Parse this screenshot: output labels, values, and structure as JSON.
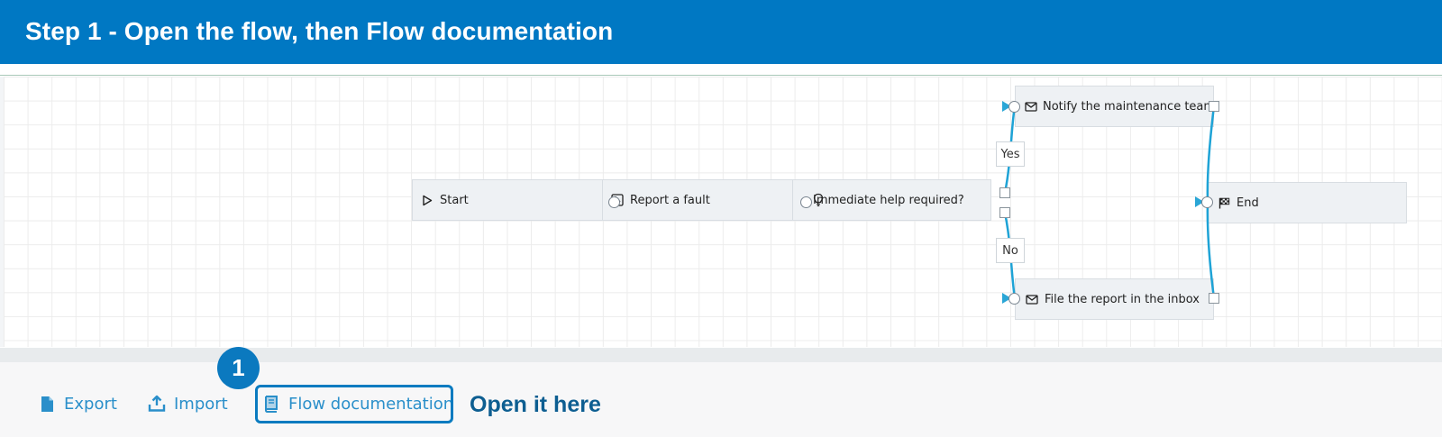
{
  "header": {
    "title": "Step 1 - Open the flow, then Flow documentation"
  },
  "flow": {
    "nodes": {
      "start": {
        "label": "Start",
        "icon": "play-outline-icon"
      },
      "report": {
        "label": "Report a fault",
        "icon": "form-icon"
      },
      "decision": {
        "label": "Immediate help required?",
        "icon": "lightbulb-icon"
      },
      "notify": {
        "label": "Notify the maintenance team",
        "icon": "envelope-icon"
      },
      "file": {
        "label": "File the report in the inbox",
        "icon": "envelope-icon"
      },
      "end": {
        "label": "End",
        "icon": "checkered-flag-icon"
      }
    },
    "edge_labels": {
      "yes": "Yes",
      "no": "No"
    },
    "colors": {
      "link": "#1ea3d6",
      "node_bg": "#eef1f4"
    }
  },
  "toolbar": {
    "export_label": "Export",
    "import_label": "Import",
    "flowdoc_label": "Flow documentation",
    "accent": "#2a8fca"
  },
  "callout": {
    "step_number": "1",
    "text": "Open it here",
    "color": "#0b79bf"
  }
}
